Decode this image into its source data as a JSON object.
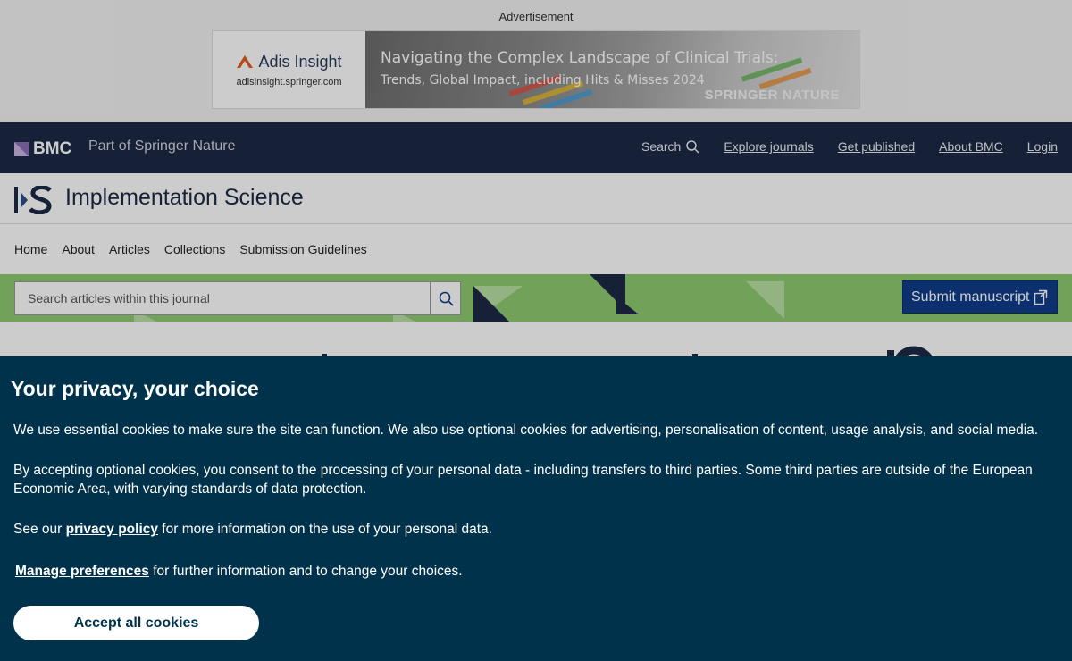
{
  "advertisement": {
    "label": "Advertisement",
    "brand_name": "Adis Insight",
    "brand_url": "adisinsight.springer.com",
    "headline": "Navigating the Complex Landscape of Clinical Trials:",
    "subheadline": "Trends, Global Impact, including Hits & Misses 2024",
    "publisher": "SPRINGER NATURE"
  },
  "bmc_header": {
    "logo_text": "BMC",
    "tagline": "Part of Springer Nature",
    "search_label": "Search",
    "links": [
      "Explore journals",
      "Get published",
      "About BMC",
      "Login"
    ]
  },
  "journal": {
    "title": "Implementation Science",
    "nav": [
      "Home",
      "About",
      "Articles",
      "Collections",
      "Submission Guidelines"
    ],
    "search_placeholder": "Search articles within this journal",
    "submit_label": "Submit manuscript"
  },
  "cookie_banner": {
    "title": "Your privacy, your choice",
    "p1": "We use essential cookies to make sure the site can function. We also use optional cookies for advertising, personalisation of content, usage analysis, and social media.",
    "p2": "By accepting optional cookies, you consent to the processing of your personal data - including transfers to third parties. Some third parties are outside of the European Economic Area, with varying standards of data protection.",
    "p3_before": "See our ",
    "privacy_link": "privacy policy",
    "p3_after": " for more information on the use of your personal data.",
    "manage_link": "Manage preferences",
    "manage_after": " for further information and to change your choices.",
    "accept_label": "Accept all cookies"
  },
  "colors": {
    "bmc_navy": "#1c2a45",
    "search_band_green": "#8fca70",
    "submit_blue": "#0f3c8a",
    "cookie_bg": "#01324b"
  }
}
